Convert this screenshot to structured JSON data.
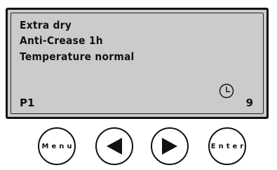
{
  "display": {
    "lines": [
      "Extra dry",
      "Anti-Crease 1h",
      "Temperature normal"
    ],
    "program": "P1",
    "time_value": "9",
    "status_icon": "clock-icon"
  },
  "buttons": {
    "menu_label": "Menu",
    "left_icon": "left-arrow-icon",
    "right_icon": "right-arrow-icon",
    "enter_label": "Enter"
  },
  "colors": {
    "lcd_background": "#cbcbcb",
    "foreground": "#111111"
  }
}
